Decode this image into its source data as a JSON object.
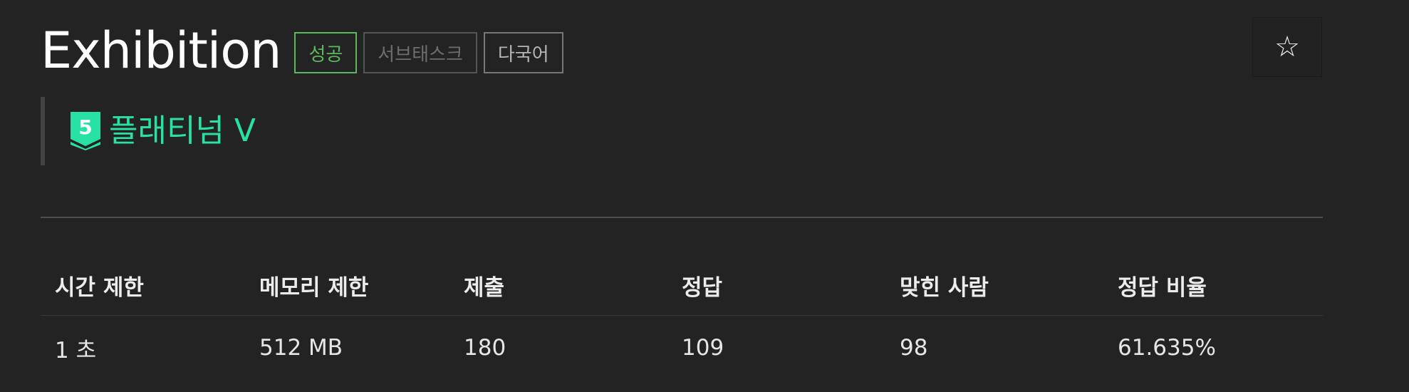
{
  "problem": {
    "title": "Exhibition",
    "badges": {
      "success": "성공",
      "subtask": "서브태스크",
      "multilang": "다국어"
    },
    "star_icon": "☆",
    "tier": {
      "level": "5",
      "label": "플래티넘 V",
      "color": "#27e2a4"
    }
  },
  "info_table": {
    "headers": [
      "시간 제한",
      "메모리 제한",
      "제출",
      "정답",
      "맞힌 사람",
      "정답 비율"
    ],
    "values": [
      "1 초",
      "512 MB",
      "180",
      "109",
      "98",
      "61.635%"
    ]
  },
  "colors": {
    "background": "#232323",
    "success": "#5cb85c",
    "tier": "#27e2a4"
  }
}
